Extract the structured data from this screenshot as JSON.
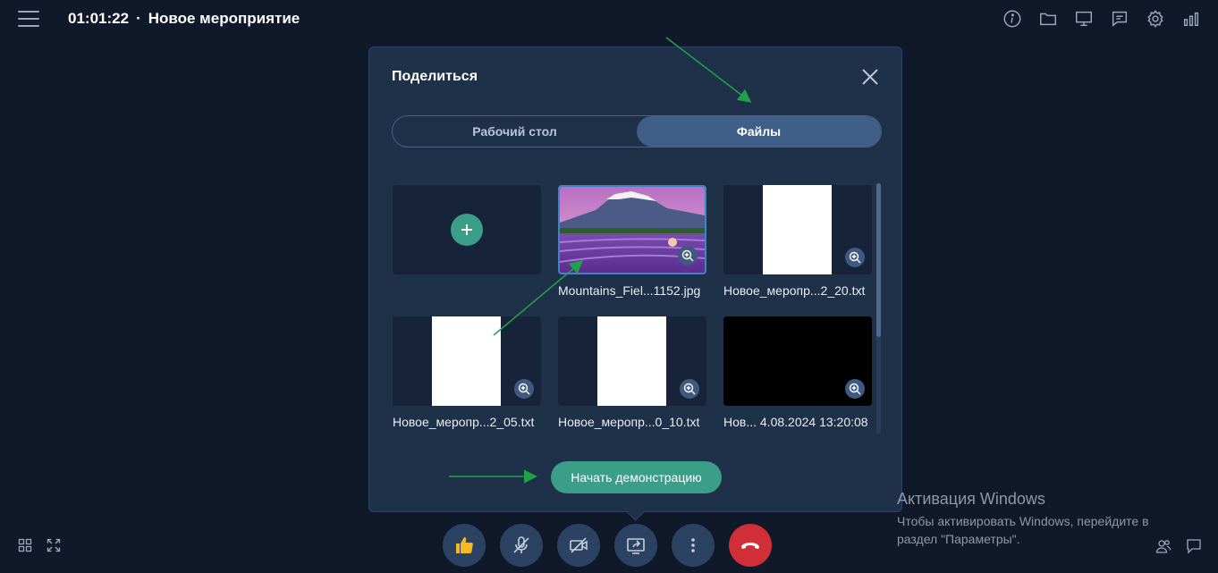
{
  "header": {
    "time": "01:01:22",
    "separator": "·",
    "event_title": "Новое мероприятие"
  },
  "share_dialog": {
    "title": "Поделиться",
    "tabs": [
      {
        "label": "Рабочий стол",
        "active": false
      },
      {
        "label": "Файлы",
        "active": true
      }
    ],
    "files": [
      {
        "name": "Mountains_Fiel...1152.jpg",
        "kind": "image",
        "selected": true
      },
      {
        "name": "Новое_меропр...2_20.txt",
        "kind": "document"
      },
      {
        "name": "Новое_меропр...2_05.txt",
        "kind": "document"
      },
      {
        "name": "Новое_меропр...0_10.txt",
        "kind": "document"
      },
      {
        "name": "Нов...  4.08.2024 13:20:08",
        "kind": "video"
      }
    ],
    "start_button": "Начать демонстрацию"
  },
  "windows_activation": {
    "title": "Активация Windows",
    "message": "Чтобы активировать Windows, перейдите в раздел \"Параметры\"."
  },
  "icons": {
    "top": [
      "info-icon",
      "folder-icon",
      "presentation-icon",
      "chat-icon",
      "gear-icon",
      "signal-icon"
    ],
    "controls": [
      "thumbs-up-icon",
      "microphone-icon",
      "camera-off-icon",
      "screen-share-icon",
      "more-icon",
      "hangup-icon"
    ]
  },
  "colors": {
    "background": "#0f1929",
    "dialog": "#1f3049",
    "accent_green": "#3a9e88",
    "active_tab": "#3f5f88",
    "hangup_red": "#d12f37",
    "annotation_arrow": "#1fa34a"
  }
}
